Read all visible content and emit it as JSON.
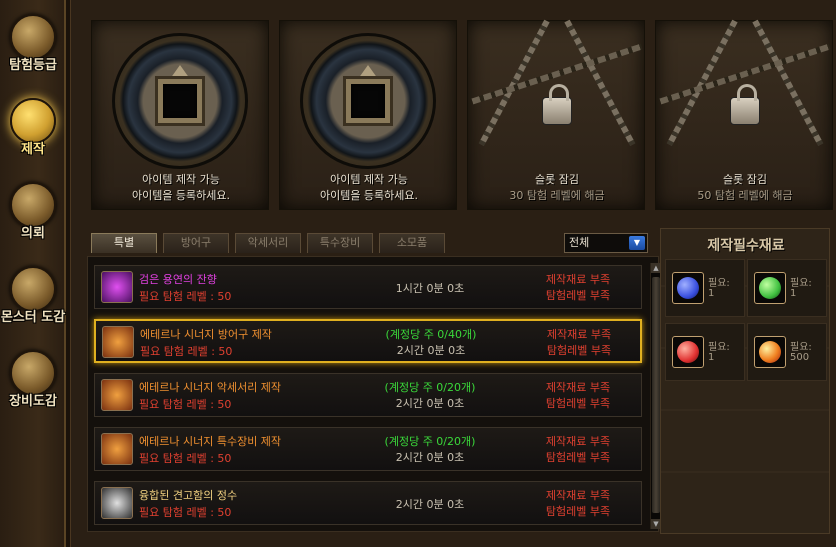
{
  "nav": [
    {
      "label": "탐험등급",
      "icon": "map-icon",
      "active": false
    },
    {
      "label": "제작",
      "icon": "anvil-icon",
      "active": true
    },
    {
      "label": "의뢰",
      "icon": "scroll-icon",
      "active": false
    },
    {
      "label": "몬스터 도감",
      "icon": "monster-book-icon",
      "active": false
    },
    {
      "label": "장비도감",
      "icon": "armor-book-icon",
      "active": false
    }
  ],
  "slots": [
    {
      "line1": "아이템 제작 가능",
      "line2": "아이템을 등록하세요.",
      "locked": false
    },
    {
      "line1": "아이템 제작 가능",
      "line2": "아이템을 등록하세요.",
      "locked": false
    },
    {
      "line1": "슬롯 잠김",
      "line2": "30 탐험 레벨에 해금",
      "locked": true
    },
    {
      "line1": "슬롯 잠김",
      "line2": "50 탐험 레벨에 해금",
      "locked": true
    }
  ],
  "tabs": [
    "특별",
    "방어구",
    "악세서리",
    "특수장비",
    "소모품"
  ],
  "filter": {
    "value": "전체"
  },
  "recipes": [
    {
      "name": "검은 용연의 잔향",
      "name_color": "#e040e0",
      "req": "필요 탐험 레벨 : 50",
      "limit": "",
      "time": "1시간 0분 0초",
      "warn1": "제작재료 부족",
      "warn2": "탐험레벨 부족",
      "selected": false,
      "icon_color": "#a030c0"
    },
    {
      "name": "에테르나 시너지 방어구 제작",
      "name_color": "#f09030",
      "req": "필요 탐험 레벨 : 50",
      "limit": "(계정당 주 0/40개)",
      "time": "2시간 0분 0초",
      "warn1": "제작재료 부족",
      "warn2": "탐험레벨 부족",
      "selected": true,
      "icon_color": "#e07020"
    },
    {
      "name": "에테르나 시너지 악세서리 제작",
      "name_color": "#f09030",
      "req": "필요 탐험 레벨 : 50",
      "limit": "(계정당 주 0/20개)",
      "time": "2시간 0분 0초",
      "warn1": "제작재료 부족",
      "warn2": "탐험레벨 부족",
      "selected": false,
      "icon_color": "#e07020"
    },
    {
      "name": "에테르나 시너지 특수장비 제작",
      "name_color": "#f09030",
      "req": "필요 탐험 레벨 : 50",
      "limit": "(계정당 주 0/20개)",
      "time": "2시간 0분 0초",
      "warn1": "제작재료 부족",
      "warn2": "탐험레벨 부족",
      "selected": false,
      "icon_color": "#e07020"
    },
    {
      "name": "융합된 견고함의 정수",
      "name_color": "#f0d080",
      "req": "필요 탐험 레벨 : 50",
      "limit": "",
      "time": "2시간 0분 0초",
      "warn1": "제작재료 부족",
      "warn2": "탐험레벨 부족",
      "selected": false,
      "icon_color": "#606060"
    }
  ],
  "materials": {
    "title": "제작필수재료",
    "items": [
      {
        "label": "필요:",
        "count": "1",
        "icon": "blue-gem-icon",
        "color": "#3a50e0"
      },
      {
        "label": "필요:",
        "count": "1",
        "icon": "green-gem-icon",
        "color": "#40c040"
      },
      {
        "label": "필요:",
        "count": "1",
        "icon": "red-gem-icon",
        "color": "#e03030"
      },
      {
        "label": "필요:",
        "count": "500",
        "icon": "fire-orb-icon",
        "color": "#f08020"
      }
    ]
  }
}
